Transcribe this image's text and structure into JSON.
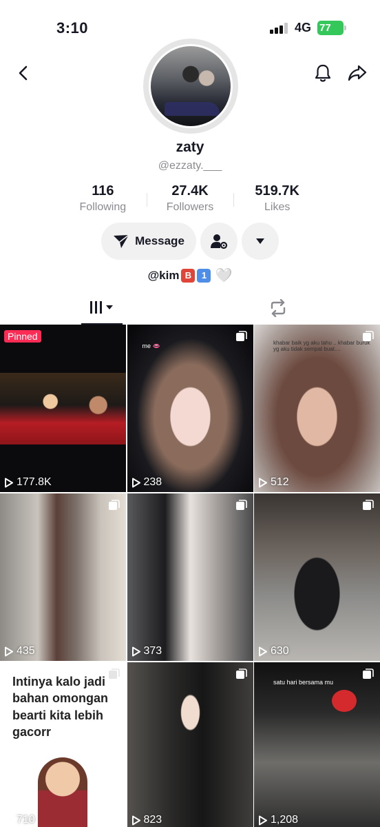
{
  "status_bar": {
    "time": "3:10",
    "network": "4G",
    "battery": "77"
  },
  "profile": {
    "display_name": "zaty",
    "username": "@ezzaty.___",
    "stats": [
      {
        "value": "116",
        "label": "Following"
      },
      {
        "value": "27.4K",
        "label": "Followers"
      },
      {
        "value": "519.7K",
        "label": "Likes"
      }
    ],
    "message_label": "Message",
    "bio": {
      "mention": "@kim",
      "badge1": "B",
      "badge2": "1",
      "heart": "🤍"
    }
  },
  "tabs": [
    {
      "icon": "grid-icon",
      "active": true
    },
    {
      "icon": "repost-icon",
      "active": false
    }
  ],
  "videos": [
    {
      "views": "177.8K",
      "pinned_label": "Pinned"
    },
    {
      "views": "238",
      "caption": "me 👄"
    },
    {
      "views": "512",
      "caption": "khabar baik yg aku tahu .. khabar buruk yg aku tidak sempat buat...."
    },
    {
      "views": "435"
    },
    {
      "views": "373"
    },
    {
      "views": "630"
    },
    {
      "views": "710",
      "quote": "Intinya kalo jadi bahan omongan bearti kita lebih gacorr"
    },
    {
      "views": "823"
    },
    {
      "views": "1,208",
      "caption": "satu hari bersama mu"
    }
  ],
  "colors": {
    "accent": "#fe2c55",
    "text": "#161823",
    "muted": "#8a8b91",
    "button_bg": "#f1f1f2"
  }
}
